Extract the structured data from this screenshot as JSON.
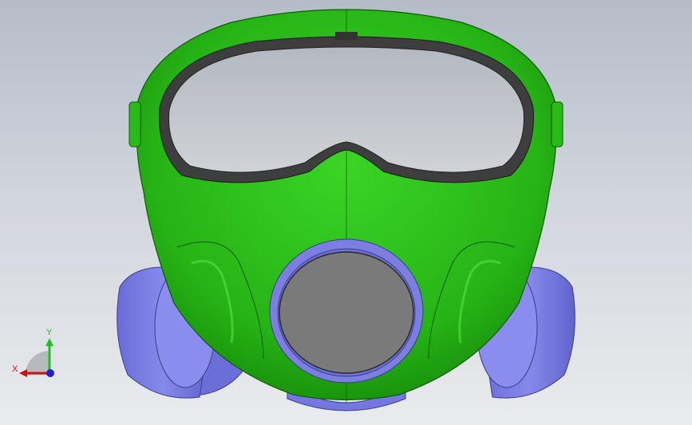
{
  "viewport": {
    "background_top": "#b4bcc8",
    "background_bottom": "#e9ebed"
  },
  "model": {
    "name": "gas-mask",
    "colors": {
      "shell": "#2fc81c",
      "shell_dark": "#1a8c0e",
      "shell_light": "#4ee03a",
      "visor_frame": "#4a4a4a",
      "lens": "#c2c6cc",
      "filter": "#7c7fe0",
      "filter_dark": "#5a5cc4",
      "valve_inner": "#7a7a7a"
    }
  },
  "triad": {
    "y_label": "Y",
    "x_label": "X",
    "y_color": "#1fbf1f",
    "x_color": "#d01010",
    "z_color": "#2020d0"
  }
}
